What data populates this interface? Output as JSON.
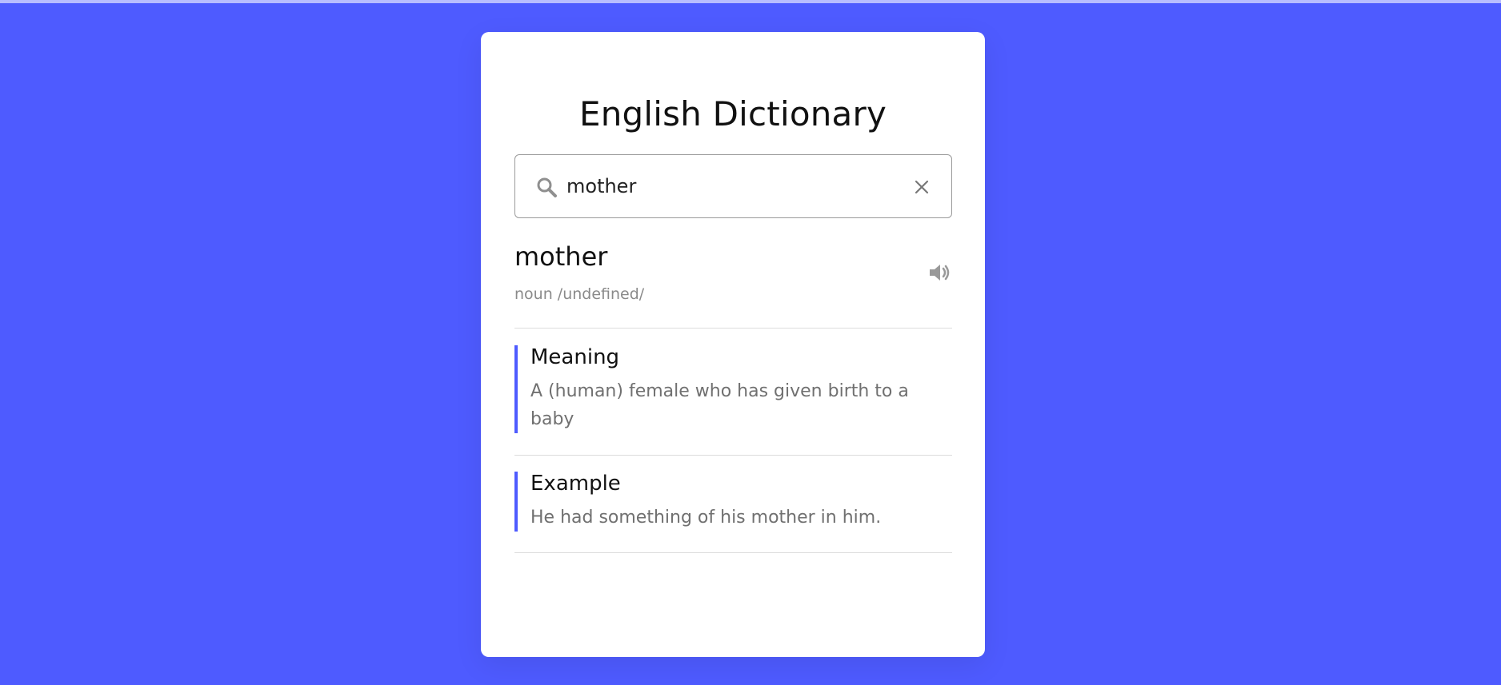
{
  "app": {
    "title": "English Dictionary"
  },
  "search": {
    "value": "mother",
    "icon": "search-icon",
    "clear_icon": "close-icon"
  },
  "result": {
    "word": "mother",
    "phonetic": "noun /undefined/",
    "audio_icon": "speaker-icon"
  },
  "meaning": {
    "title": "Meaning",
    "text": "A (human) female who has given birth to a baby"
  },
  "example": {
    "title": "Example",
    "text": "He had something of his mother in him."
  },
  "colors": {
    "background": "#4e5bff",
    "card": "#ffffff",
    "accent": "#4e5bff"
  }
}
